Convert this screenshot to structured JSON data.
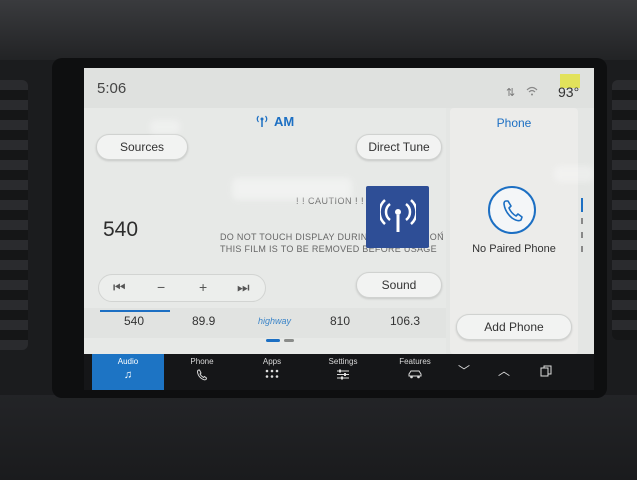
{
  "status_bar": {
    "time": "5:06",
    "temperature": "93°"
  },
  "audio": {
    "band": "AM",
    "sources_label": "Sources",
    "direct_tune_label": "Direct Tune",
    "sound_label": "Sound",
    "current_frequency": "540",
    "controls": {
      "prev": "⏮",
      "minus": "−",
      "plus": "+",
      "next": "⏭"
    },
    "presets": [
      "540",
      "89.9",
      "810",
      "106.3"
    ],
    "highway_logo": "highway",
    "accent_color": "#1c6fc3"
  },
  "film_notice": {
    "caution": "! ! CAUTION ! ! !",
    "line1": "DO NOT TOUCH DISPLAY DURING INSTALLATION",
    "line2": "THIS FILM IS TO BE REMOVED BEFORE USAGE"
  },
  "phone": {
    "title": "Phone",
    "status": "No Paired Phone",
    "add_label": "Add Phone"
  },
  "nav": {
    "items": [
      {
        "label": "Audio",
        "icon": "music-note-icon"
      },
      {
        "label": "Phone",
        "icon": "phone-icon"
      },
      {
        "label": "Apps",
        "icon": "apps-grid-icon"
      },
      {
        "label": "Settings",
        "icon": "settings-sliders-icon"
      },
      {
        "label": "Features",
        "icon": "car-icon"
      }
    ],
    "active": "Audio",
    "active_color": "#1d74c4"
  }
}
